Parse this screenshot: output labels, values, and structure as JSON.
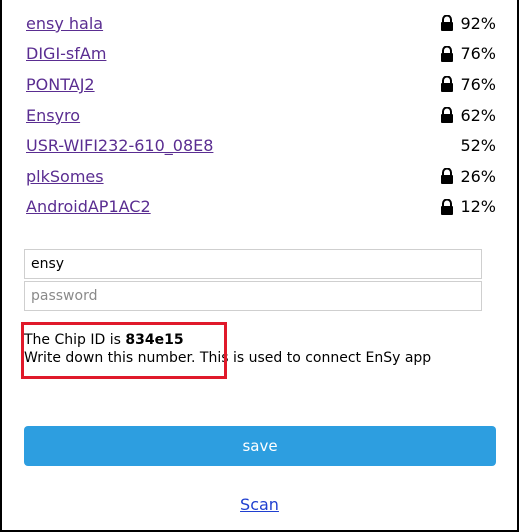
{
  "networks": [
    {
      "ssid": "ensy hala",
      "locked": true,
      "quality": "92%"
    },
    {
      "ssid": "DIGI-sfAm",
      "locked": true,
      "quality": "76%"
    },
    {
      "ssid": "PONTAJ2",
      "locked": true,
      "quality": "76%"
    },
    {
      "ssid": "Ensyro",
      "locked": true,
      "quality": "62%"
    },
    {
      "ssid": "USR-WIFI232-610_08E8",
      "locked": false,
      "quality": "52%"
    },
    {
      "ssid": "plkSomes",
      "locked": true,
      "quality": "26%"
    },
    {
      "ssid": "AndroidAP1AC2",
      "locked": true,
      "quality": "12%"
    }
  ],
  "form": {
    "ssid_value": "ensy",
    "password_placeholder": "password",
    "save_label": "save"
  },
  "chip": {
    "line1_prefix": "The Chip ID is ",
    "id": "834e15",
    "line2_part1": "Write down this number.",
    "line2_part2": " This is used to connect EnSy app"
  },
  "scan_label": "Scan",
  "colors": {
    "link": "#5a2d91",
    "button": "#2d9ee0",
    "highlight_border": "#e0192a",
    "scan_link": "#1f3fd0"
  },
  "icons": {
    "lock": "lock-icon"
  }
}
